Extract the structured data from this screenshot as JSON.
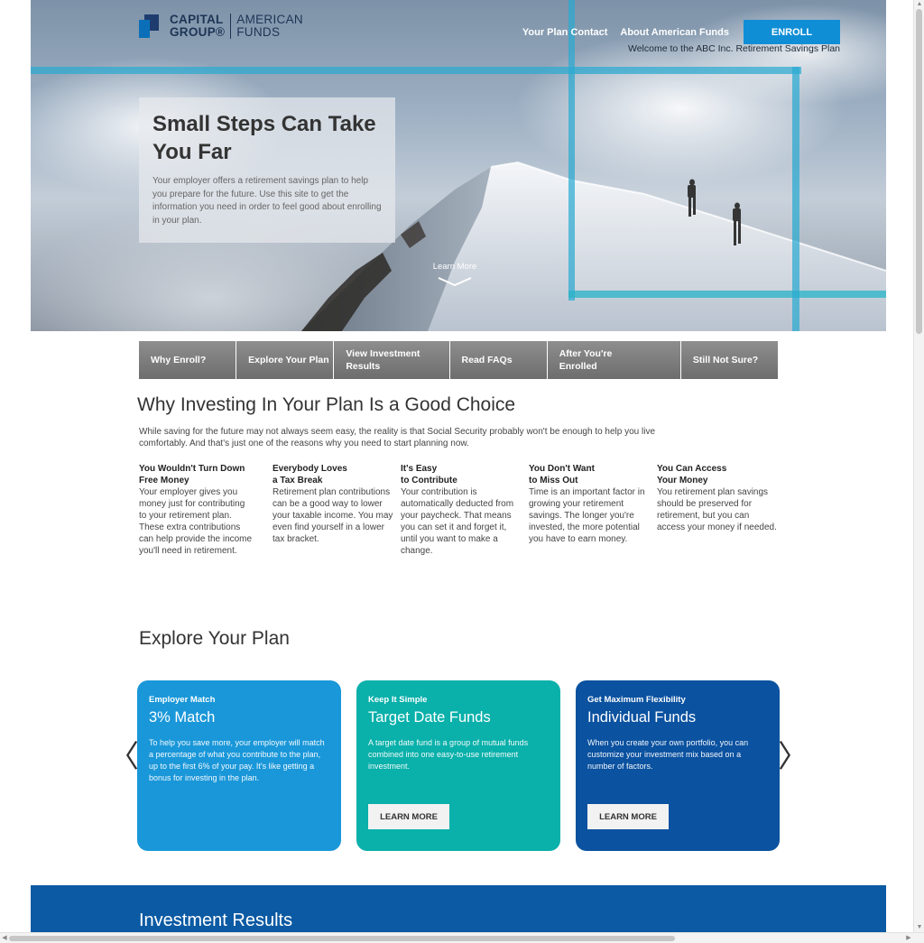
{
  "brand": {
    "logo_line1": "CAPITAL",
    "logo_line2": "GROUP®",
    "logo_right1": "AMERICAN",
    "logo_right2": "FUNDS"
  },
  "topnav": {
    "plan_contact": "Your Plan Contact",
    "about": "About American Funds",
    "enroll": "ENROLL",
    "welcome": "Welcome to the ABC Inc. Retirement Savings Plan"
  },
  "hero": {
    "title_line1": "Small Steps Can Take",
    "title_line2": "You Far",
    "subtitle": "Your employer offers a retirement savings plan to help you prepare for the future. Use this site to get the information you need in order to feel good about enrolling in your plan.",
    "learn_more": "Learn More"
  },
  "tabs": [
    {
      "label": "Why Enroll?"
    },
    {
      "label": "Explore Your Plan"
    },
    {
      "label": "View Investment Results"
    },
    {
      "label": "Read FAQs"
    },
    {
      "label": "After You're Enrolled"
    },
    {
      "label": "Still Not Sure?"
    }
  ],
  "why": {
    "title": "Why Investing In Your Plan Is a Good Choice",
    "intro": "While saving for the future may not always seem easy, the reality is that Social Security probably won't be enough to help you live comfortably. And that's just one of the reasons why you need to start planning now.",
    "reasons": [
      {
        "h1": "You Wouldn't Turn Down",
        "h2": "Free Money",
        "body": "Your employer gives you money just for contributing to your retirement plan. These extra contributions can help provide the income you'll need in retirement."
      },
      {
        "h1": "Everybody Loves",
        "h2": "a Tax Break",
        "body": "Retirement plan contributions can be a good way to lower your taxable income. You may even find yourself in a lower tax bracket."
      },
      {
        "h1": "It's Easy",
        "h2": "to Contribute",
        "body": "Your contribution is automatically deducted from your paycheck. That means you can set it and forget it, until you want to make a change."
      },
      {
        "h1": "You Don't Want",
        "h2": "to Miss Out",
        "body": "Time is an important factor in growing your retirement savings. The longer you're invested, the more potential you have to earn money."
      },
      {
        "h1": "You Can Access",
        "h2": "Your Money",
        "body": "You retirement plan savings should be preserved for retirement, but you can access your money if needed."
      }
    ]
  },
  "explore": {
    "title": "Explore Your Plan",
    "prev_arrow": "〈",
    "next_arrow": "〉",
    "cards": [
      {
        "eyebrow": "Employer Match",
        "title": "3% Match",
        "desc": "To help you save more, your employer will match a percentage of what you contribute to the plan, up to the first 6% of your pay. It's like getting a bonus for investing in the plan.",
        "color": "#1a97d9"
      },
      {
        "eyebrow": "Keep It Simple",
        "title": "Target Date Funds",
        "desc": "A target date fund is a group of mutual funds combined into one easy-to-use retirement investment.",
        "button": "LEARN MORE",
        "color": "#0ab0aa"
      },
      {
        "eyebrow": "Get Maximum Flexibility",
        "title": "Individual Funds",
        "desc": "When you create your own portfolio, you can customize your investment mix based on a number of factors.",
        "button": "LEARN MORE",
        "color": "#0b52a0"
      }
    ]
  },
  "results": {
    "title": "Investment Results"
  }
}
